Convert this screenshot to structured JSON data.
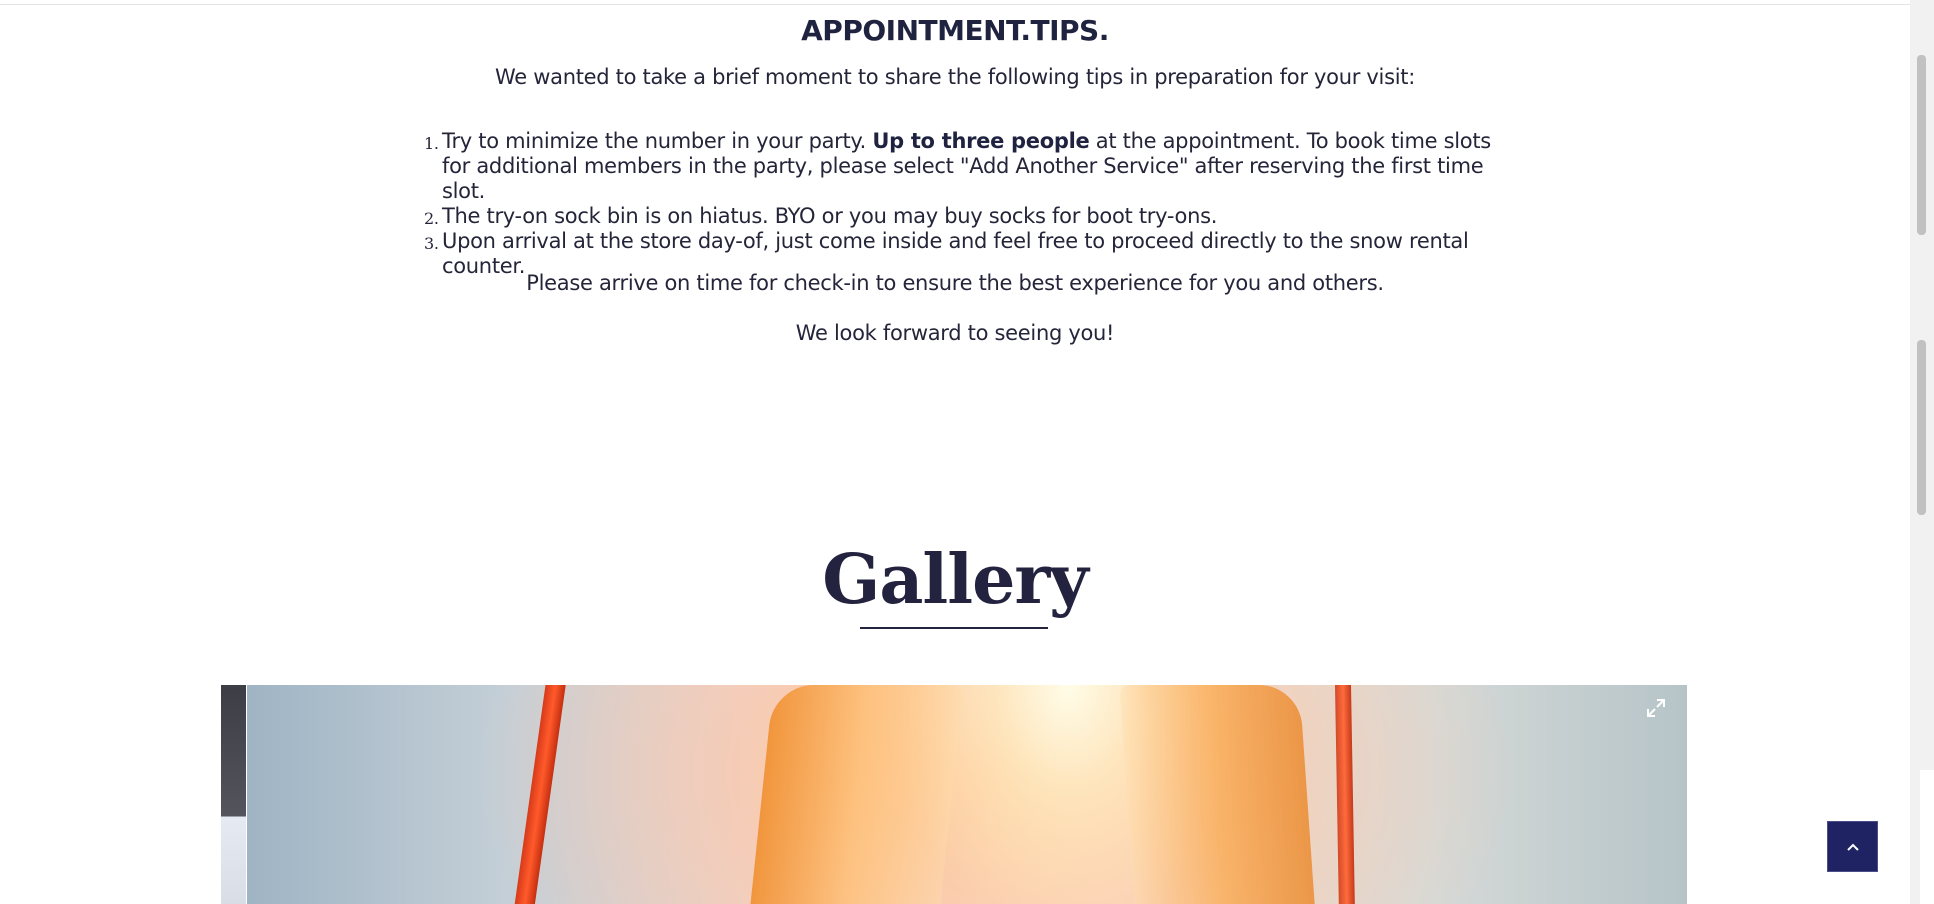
{
  "tips": {
    "title": "APPOINTMENT.TIPS.",
    "intro": "We wanted to take a brief moment to share the following tips in preparation for your visit:",
    "items": [
      {
        "number": "1.",
        "before": "Try to minimize the number in your party.  ",
        "bold": "Up to three people",
        "after": " at the appointment.  To book time slots for additional members in the party, please select \"Add Another Service\" after reserving the first time slot."
      },
      {
        "number": "2.",
        "text": "The try-on sock bin is on hiatus. BYO or you may buy socks for boot try-ons."
      },
      {
        "number": "3.",
        "text": "Upon arrival at the store day-of, just come inside and feel free to proceed directly to the snow rental counter."
      }
    ],
    "note_1": "Please arrive on time for check-in to ensure the best experience for you and others.",
    "note_2": "We look forward to seeing you!"
  },
  "gallery": {
    "heading": "Gallery",
    "expand_icon": "expand-icon"
  },
  "scroll_top": {
    "icon": "chevron-up-icon"
  },
  "colors": {
    "primary_text": "#23233f",
    "scroll_button": "#1f2363"
  }
}
